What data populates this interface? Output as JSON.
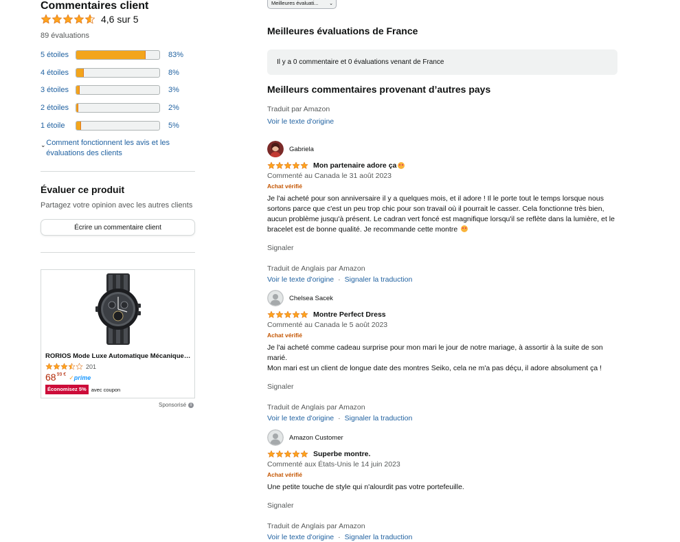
{
  "summary": {
    "title": "Commentaires client",
    "avg_text": "4,6 sur 5",
    "avg_stars": 4.6,
    "total": "89 évaluations",
    "histogram": [
      {
        "label": "5 étoiles",
        "pct": 83,
        "pct_text": "83%"
      },
      {
        "label": "4 étoiles",
        "pct": 8,
        "pct_text": "8%"
      },
      {
        "label": "3 étoiles",
        "pct": 3,
        "pct_text": "3%"
      },
      {
        "label": "2 étoiles",
        "pct": 2,
        "pct_text": "2%"
      },
      {
        "label": "1 étoile",
        "pct": 5,
        "pct_text": "5%"
      }
    ],
    "how_link": "Comment fonctionnent les avis et les évaluations des clients"
  },
  "evaluate": {
    "title": "Évaluer ce produit",
    "subtitle": "Partagez votre opinion avec les autres clients",
    "button": "Écrire un commentaire client"
  },
  "ad": {
    "title": "RORIOS Mode Luxe Automatique Mécanique Montre",
    "rating": 3.5,
    "rating_count": "201",
    "price_whole": "68",
    "price_fraction": "99 €",
    "prime_label": "prime",
    "badge": "Économisez 5%",
    "coupon_text": "avec coupon",
    "sponsored": "Sponsorisé"
  },
  "reviews_section": {
    "sort_label": "Meilleures évaluati...",
    "france_title": "Meilleures évaluations de France",
    "france_empty": "Il y a 0 commentaire et 0 évaluations venant de France",
    "other_title": "Meilleurs commentaires provenant d’autres pays",
    "translated_by": "Traduit par Amazon",
    "see_original": "Voir le texte d'origine"
  },
  "reviews": [
    {
      "user": "Gabriela",
      "stars": 5,
      "title": "Mon partenaire adore ça",
      "meta": "Commenté au Canada le 31 août 2023",
      "verified": "Achat vérifié",
      "body": [
        "Je l'ai acheté pour son anniversaire il y a quelques mois, et il adore ! Il le porte tout le temps lorsque nous sortons parce que c'est un peu trop chic pour son travail où il pourrait le casser. Cela fonctionne très bien, aucun problème jusqu'à présent. Le cadran vert foncé est magnifique lorsqu'il se reflète dans la lumière, et le bracelet est de bonne qualité. Je recommande cette montre"
      ],
      "report": "Signaler",
      "translated": "Traduit de Anglais par Amazon",
      "link_original": "Voir le texte d'origine",
      "link_report_translation": "Signaler la traduction"
    },
    {
      "user": "Chelsea Sacek",
      "stars": 5,
      "title": "Montre Perfect Dress",
      "meta": "Commenté au Canada le 5 août 2023",
      "verified": "Achat vérifié",
      "body": [
        "Je l'ai acheté comme cadeau surprise pour mon mari le jour de notre mariage, à assortir à la suite de son marié.",
        "Mon mari est un client de longue date des montres Seiko, cela ne m'a pas déçu, il adore absolument ça !"
      ],
      "report": "Signaler",
      "translated": "Traduit de Anglais par Amazon",
      "link_original": "Voir le texte d'origine",
      "link_report_translation": "Signaler la traduction"
    },
    {
      "user": "Amazon Customer",
      "stars": 5,
      "title": "Superbe montre.",
      "meta": "Commenté aux États-Unis le 14 juin 2023",
      "verified": "Achat vérifié",
      "body": [
        "Une petite touche de style qui n'alourdit pas votre portefeuille."
      ],
      "report": "Signaler",
      "translated": "Traduit de Anglais par Amazon",
      "link_original": "Voir le texte d'origine",
      "link_report_translation": "Signaler la traduction"
    }
  ],
  "colors": {
    "star": "#ffa41c",
    "link": "#2162a1",
    "verified": "#c45500",
    "price": "#b12704",
    "badge": "#cc0c39"
  }
}
